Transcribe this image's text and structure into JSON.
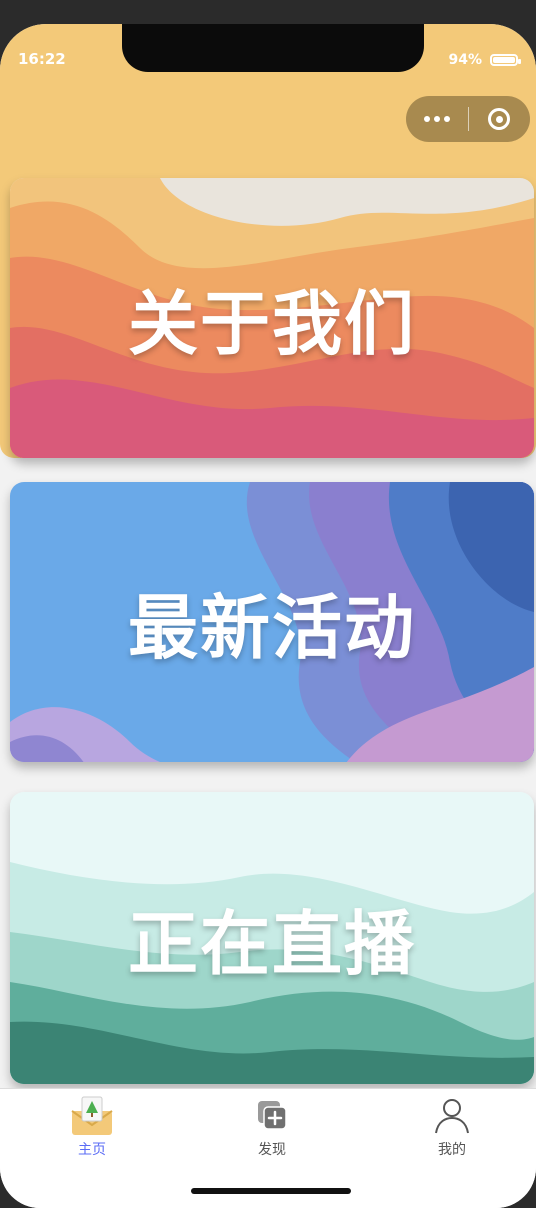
{
  "status": {
    "time": "16:22",
    "battery": "94%"
  },
  "cards": [
    {
      "label": "关于我们",
      "theme": "orange"
    },
    {
      "label": "最新活动",
      "theme": "blue"
    },
    {
      "label": "正在直播",
      "theme": "green"
    }
  ],
  "tabbar": {
    "items": [
      {
        "label": "主页",
        "icon": "home-envelope-icon",
        "active": true,
        "color": "#5b6cf5"
      },
      {
        "label": "发现",
        "icon": "discover-add-icon",
        "active": false,
        "color": "#555555"
      },
      {
        "label": "我的",
        "icon": "user-profile-icon",
        "active": false,
        "color": "#555555"
      }
    ]
  },
  "colors": {
    "header": "#f3c979",
    "capsule": "#a88a4f",
    "active_tab": "#5b6cf5"
  }
}
